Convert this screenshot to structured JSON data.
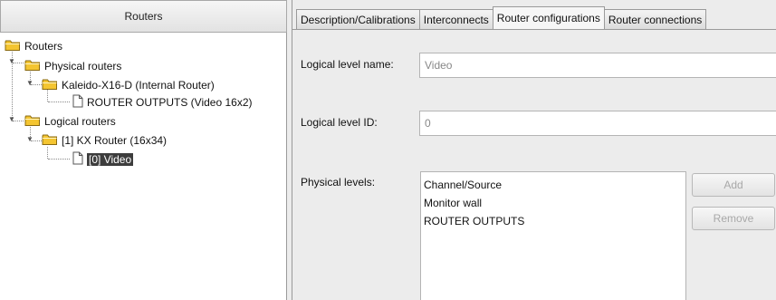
{
  "routers_panel": {
    "header": "Routers",
    "tree": {
      "root": "Routers",
      "physical": "Physical routers",
      "kaleido": "Kaleido-X16-D (Internal Router)",
      "router_outputs": "ROUTER OUTPUTS (Video 16x2)",
      "logical": "Logical routers",
      "kx_router": "[1] KX Router (16x34)",
      "video": "[0] Video"
    }
  },
  "tabs": [
    "Description/Calibrations",
    "Interconnects",
    "Router configurations",
    "Router connections"
  ],
  "form": {
    "level_name_label": "Logical level name:",
    "level_name_value": "Video",
    "level_id_label": "Logical level ID:",
    "level_id_value": "0",
    "physical_levels_label": "Physical levels:",
    "physical_levels": [
      "Channel/Source",
      "Monitor wall",
      "ROUTER OUTPUTS"
    ],
    "add_button": "Add",
    "remove_button": "Remove"
  }
}
